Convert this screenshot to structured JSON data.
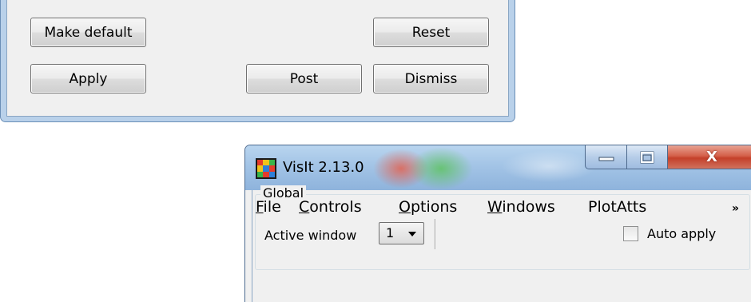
{
  "dialog": {
    "buttons": {
      "make_default": "Make default",
      "reset": "Reset",
      "apply": "Apply",
      "post": "Post",
      "dismiss": "Dismiss"
    }
  },
  "visit_window": {
    "title": "VisIt 2.13.0",
    "menu": [
      {
        "mnemonic": "F",
        "rest": "ile"
      },
      {
        "mnemonic": "C",
        "rest": "ontrols"
      },
      {
        "mnemonic": "O",
        "rest": "ptions"
      },
      {
        "mnemonic": "W",
        "rest": "indows"
      },
      {
        "mnemonic": "",
        "rest": "PlotAtts"
      }
    ],
    "more_glyph": "»",
    "group_title": "Global",
    "active_window_label": "Active window",
    "active_window_value": "1",
    "auto_apply_label": "Auto apply",
    "close_glyph": "X"
  },
  "colors": {
    "window_frame": "#b9d1ea",
    "client_bg": "#f0f0f0",
    "close_button": "#c4402a"
  }
}
